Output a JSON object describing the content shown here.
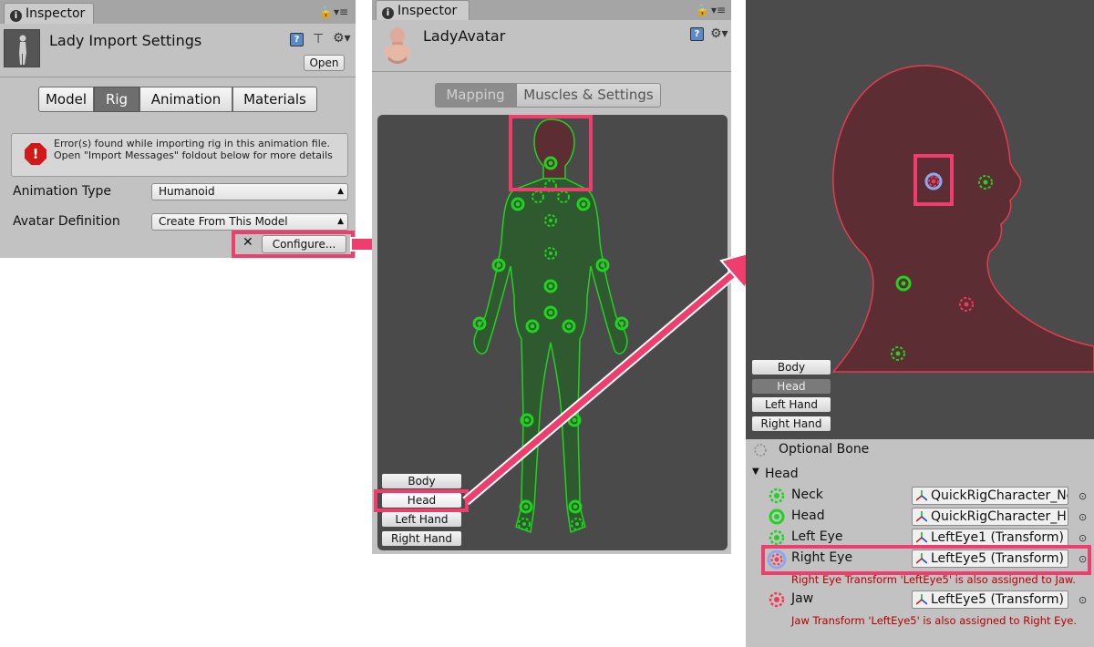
{
  "panel1": {
    "tab_label": "Inspector",
    "title": "Lady Import Settings",
    "open_label": "Open",
    "tabs": [
      {
        "label": "Model",
        "active": false
      },
      {
        "label": "Rig",
        "active": true
      },
      {
        "label": "Animation",
        "active": false
      },
      {
        "label": "Materials",
        "active": false
      }
    ],
    "error_text": "Error(s) found while importing rig in this animation file. Open \"Import Messages\" foldout below for more details",
    "animation_type_label": "Animation Type",
    "animation_type_value": "Humanoid",
    "avatar_definition_label": "Avatar Definition",
    "avatar_definition_value": "Create From This Model",
    "close_glyph": "✕",
    "configure_label": "Configure..."
  },
  "panel2": {
    "tab_label": "Inspector",
    "title": "LadyAvatar",
    "tabs": [
      {
        "label": "Mapping",
        "active": true
      },
      {
        "label": "Muscles & Settings",
        "active": false
      }
    ],
    "body_buttons": [
      "Body",
      "Head",
      "Left Hand",
      "Right Hand"
    ],
    "selected_button": "Head"
  },
  "panel3": {
    "body_buttons": [
      "Body",
      "Head",
      "Left Hand",
      "Right Hand"
    ],
    "selected_button": "Head",
    "optional_bone_label": "Optional Bone",
    "section_label": "Head",
    "bones": [
      {
        "name": "Neck",
        "field": "QuickRigCharacter_Ne",
        "state": "ok"
      },
      {
        "name": "Head",
        "field": "QuickRigCharacter_H",
        "state": "ok"
      },
      {
        "name": "Left Eye",
        "field": "LeftEye1 (Transform)",
        "state": "ok-optional"
      },
      {
        "name": "Right Eye",
        "field": "LeftEye5 (Transform)",
        "state": "error-selected",
        "error": "Right Eye Transform 'LeftEye5' is also assigned to Jaw."
      },
      {
        "name": "Jaw",
        "field": "LeftEye5 (Transform)",
        "state": "error-optional",
        "error": "Jaw Transform 'LeftEye5' is also assigned to Right Eye."
      }
    ]
  },
  "colors": {
    "highlight": "#ef3e6e",
    "bone_ok": "#1fd31f",
    "bone_error": "#f0395a",
    "body_fill": "#2f5a2f",
    "head_fill": "#5c2e33",
    "error_text": "#b30000"
  },
  "icons": [
    "info-icon",
    "lock-icon",
    "menu-icon",
    "help-icon",
    "layout-icon",
    "gear-icon",
    "error-icon",
    "dropdown-arrow-icon",
    "close-icon",
    "arrow-right-icon",
    "transform-axis-icon",
    "object-picker-icon",
    "foldout-icon"
  ]
}
